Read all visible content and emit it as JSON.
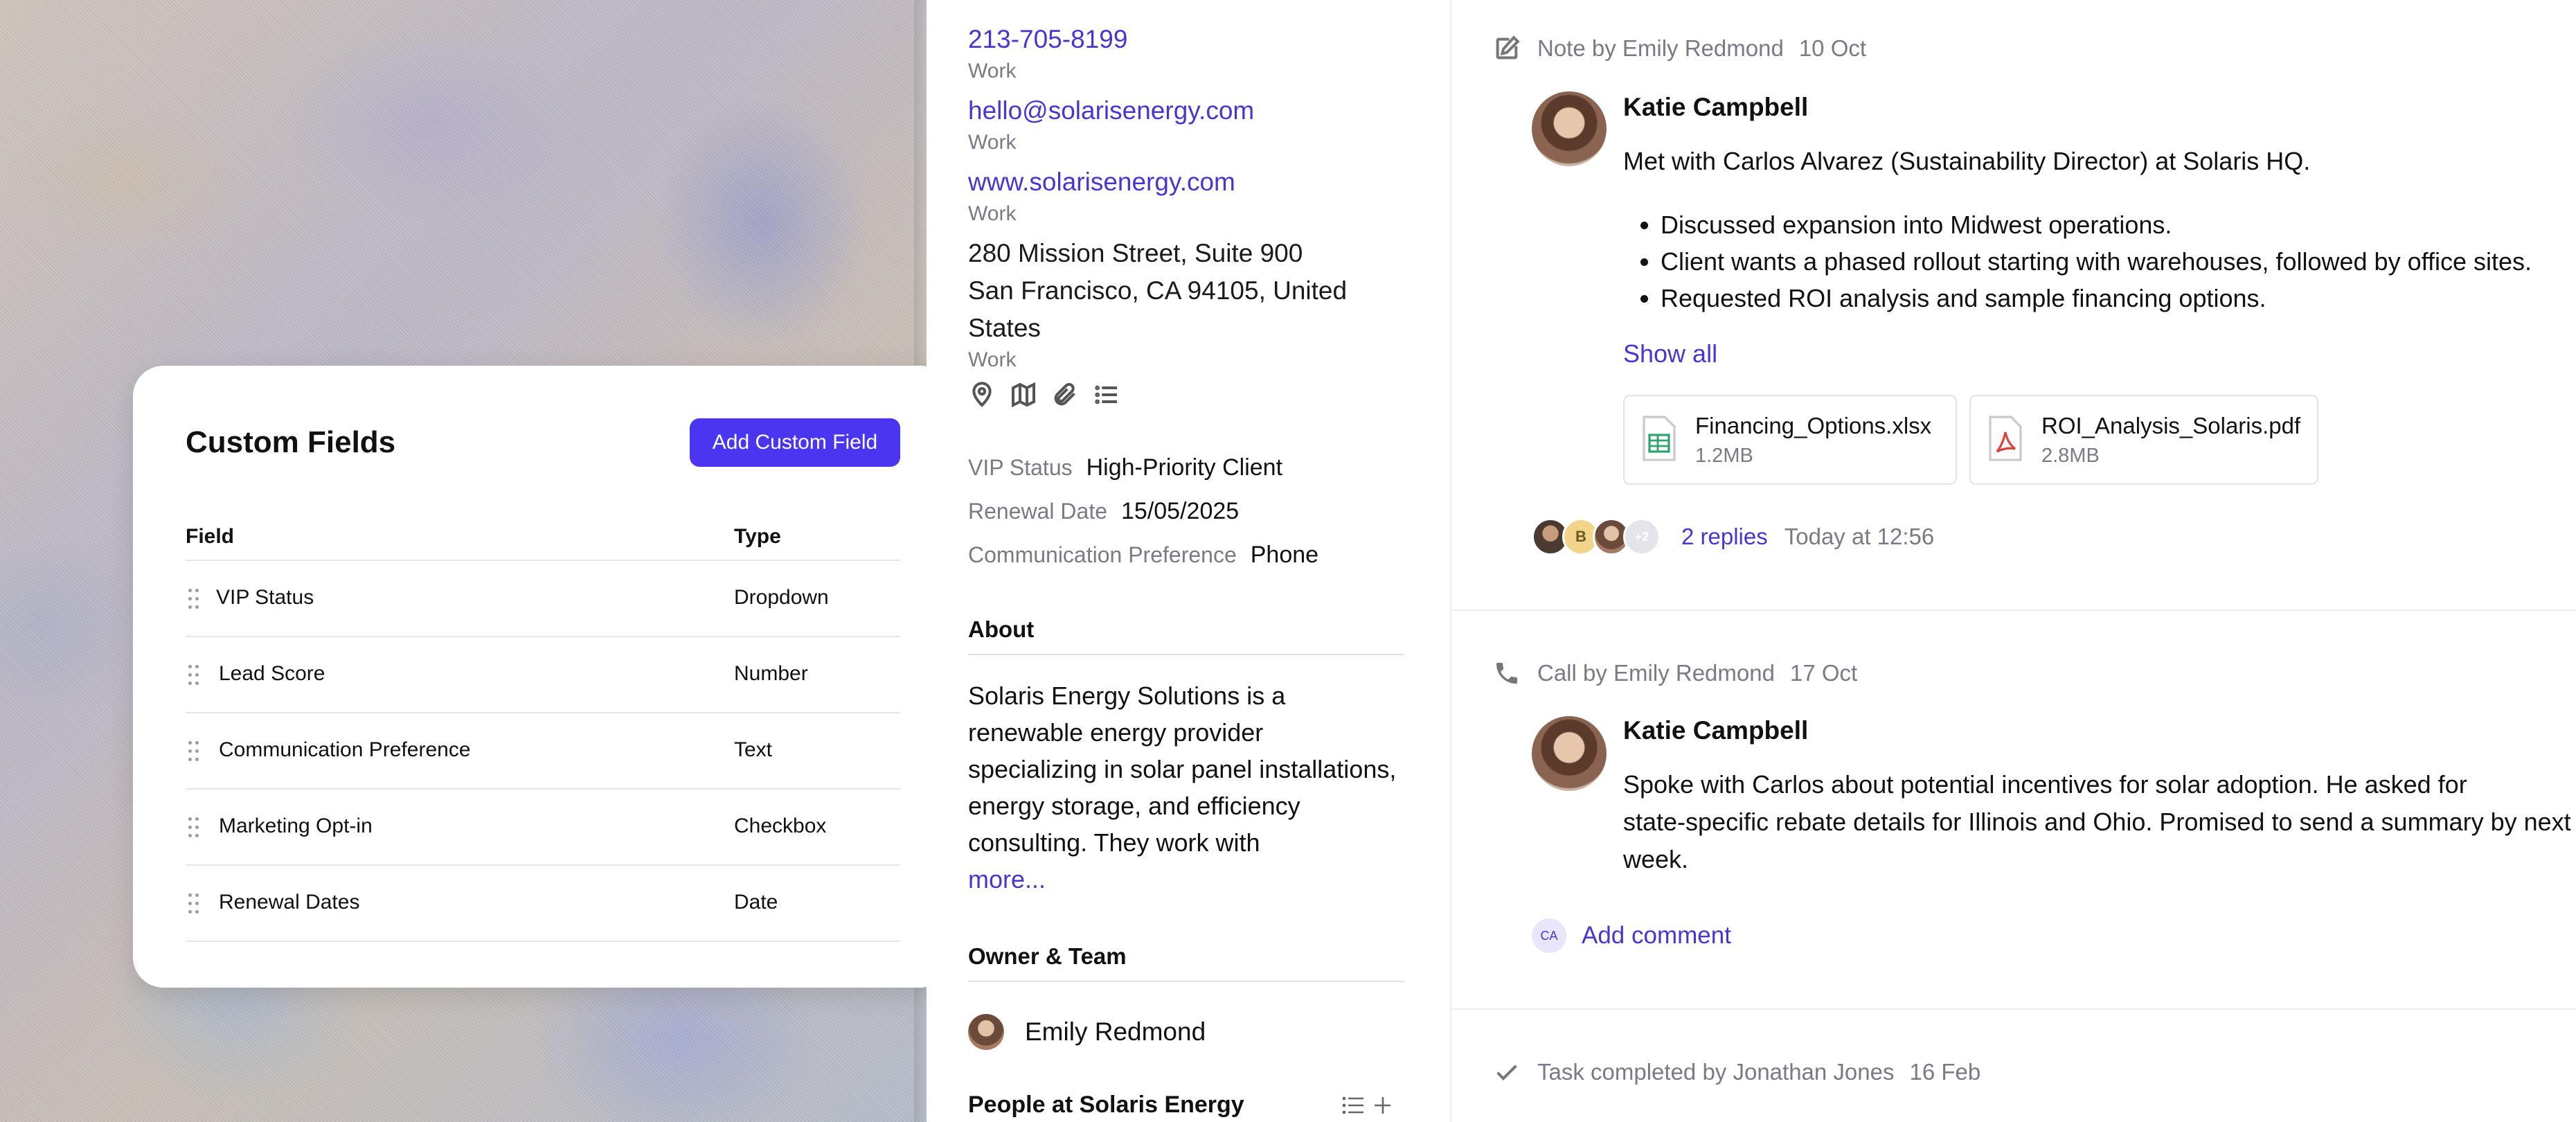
{
  "custom_fields": {
    "title": "Custom Fields",
    "add_button": "Add Custom Field",
    "col_field": "Field",
    "col_type": "Type",
    "rows": [
      {
        "field": "VIP Status",
        "type": "Dropdown"
      },
      {
        "field": "Lead Score",
        "type": "Number"
      },
      {
        "field": "Communication Preference",
        "type": "Text"
      },
      {
        "field": "Marketing Opt-in",
        "type": "Checkbox"
      },
      {
        "field": "Renewal Dates",
        "type": "Date"
      }
    ]
  },
  "contact": {
    "phone": "213-705-8199",
    "phone_type": "Work",
    "email": "hello@solarisenergy.com",
    "email_type": "Work",
    "website": "www.solarisenergy.com",
    "website_type": "Work",
    "address_line1": "280 Mission Street, Suite 900",
    "address_line2": "San Francisco, CA 94105, United",
    "address_line3": "States",
    "address_type": "Work",
    "icons": [
      "map-pin-icon",
      "map-icon",
      "paperclip-icon",
      "list-icon"
    ]
  },
  "attributes": {
    "vip_label": "VIP Status",
    "vip_value": "High-Priority Client",
    "renewal_label": "Renewal Date",
    "renewal_value": "15/05/2025",
    "comm_label": "Communication Preference",
    "comm_value": "Phone"
  },
  "about": {
    "heading": "About",
    "line1": "Solaris Energy Solutions is a",
    "line2": "renewable energy provider",
    "line3": "specializing in solar panel installations,",
    "line4": "energy storage, and efficiency",
    "line5": "consulting. They work with",
    "more": "more..."
  },
  "owner": {
    "heading": "Owner & Team",
    "name": "Emily Redmond"
  },
  "people": {
    "heading": "People at Solaris Energy"
  },
  "activity": {
    "note": {
      "type_label": "Note by Emily Redmond",
      "date": "10 Oct",
      "author": "Katie Campbell",
      "text": "Met with Carlos Alvarez (Sustainability Director) at Solaris HQ.",
      "bullets": [
        "Discussed expansion into Midwest operations.",
        "Client wants a phased rollout starting with warehouses, followed by office sites.",
        "Requested ROI analysis and sample financing options."
      ],
      "show_all": "Show all",
      "files": [
        {
          "name": "Financing_Options.xlsx",
          "size": "1.2MB",
          "icon": "spreadsheet-icon"
        },
        {
          "name": "ROI_Analysis_Solaris.pdf",
          "size": "2.8MB",
          "icon": "pdf-icon"
        }
      ],
      "avatar_initial": "B",
      "more_count": "+2",
      "replies": "2 replies",
      "reply_time": "Today at 12:56"
    },
    "call": {
      "type_label": "Call by Emily Redmond",
      "date": "17 Oct",
      "author": "Katie Campbell",
      "line1": "Spoke with Carlos about potential incentives for solar adoption. He asked for",
      "line2": "state-specific rebate details for Illinois and Ohio. Promised to send a summary by next",
      "line3": "week.",
      "comment_initials": "CA",
      "add_comment": "Add comment"
    },
    "task": {
      "type_label": "Task completed by Jonathan Jones",
      "date": "16 Feb"
    }
  },
  "colors": {
    "accent": "#4a35f0",
    "link": "#4a35d0",
    "muted": "#7a7a86",
    "divider": "#ececf0"
  }
}
